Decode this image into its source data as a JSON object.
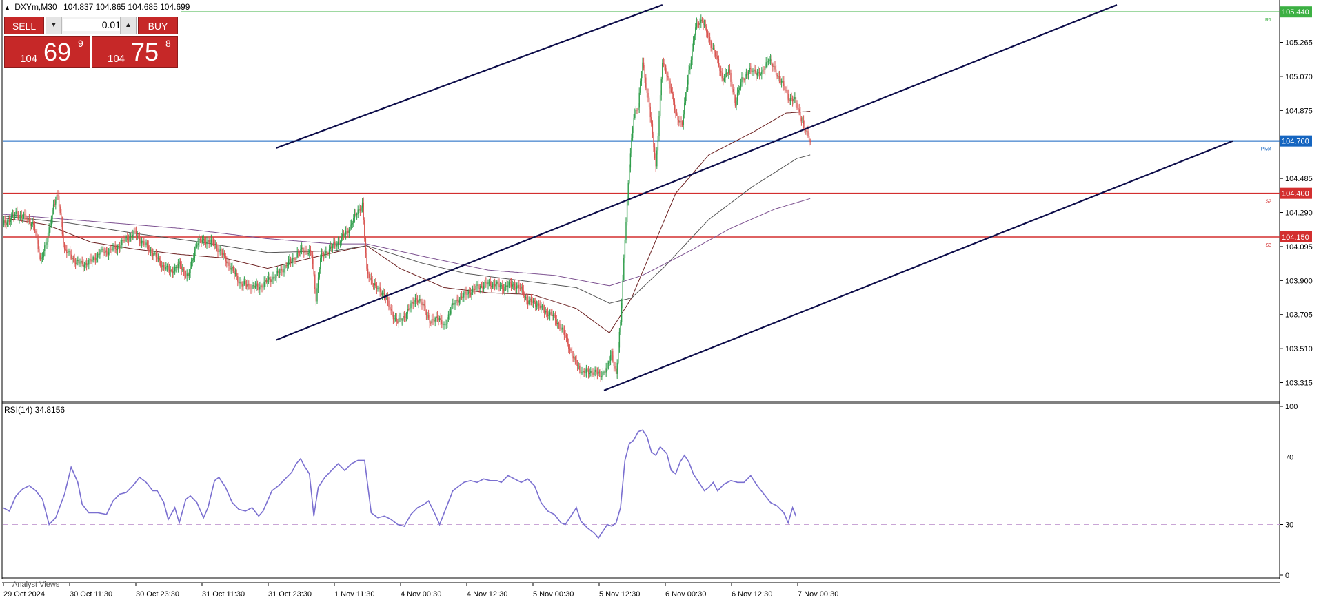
{
  "header": {
    "symbol": "DXYm,M30",
    "ohlc": "104.837 104.865 104.685 104.699"
  },
  "trade_panel": {
    "sell_label": "SELL",
    "buy_label": "BUY",
    "lot": "0.01",
    "bid": {
      "prefix": "104",
      "big": "69",
      "sup": "9"
    },
    "ask": {
      "prefix": "104",
      "big": "75",
      "sup": "8"
    }
  },
  "indicator_label": "RSI(14) 34.8156",
  "footer_label": "Analyst Views",
  "chart_data": [
    {
      "type": "candlestick",
      "title": "DXYm,M30",
      "price_axis_ticks": [
        103.315,
        103.51,
        103.705,
        103.9,
        104.095,
        104.29,
        104.485,
        104.875,
        105.07,
        105.265
      ],
      "time_axis_ticks": [
        "29 Oct 2024",
        "30 Oct 11:30",
        "30 Oct 23:30",
        "31 Oct 11:30",
        "31 Oct 23:30",
        "1 Nov 11:30",
        "4 Nov 00:30",
        "4 Nov 12:30",
        "5 Nov 00:30",
        "5 Nov 12:30",
        "6 Nov 00:30",
        "6 Nov 12:30",
        "7 Nov 00:30"
      ],
      "ylim": [
        103.25,
        105.5
      ],
      "levels": [
        {
          "price": 105.44,
          "label": "105.440",
          "tag": "R1",
          "color": "#3cb043"
        },
        {
          "price": 104.7,
          "label": "104.700",
          "tag": "Pivot",
          "color": "#1565c0"
        },
        {
          "price": 104.4,
          "label": "104.400",
          "tag": "S2",
          "color": "#d32f2f"
        },
        {
          "price": 104.15,
          "label": "104.150",
          "tag": "S3",
          "color": "#d32f2f"
        }
      ],
      "up_color": "#2e9d4a",
      "down_color": "#d9534f",
      "channel_color": "#0d0d4a",
      "close_path": [
        [
          0,
          104.22
        ],
        [
          6,
          104.25
        ],
        [
          12,
          104.28
        ],
        [
          20,
          104.26
        ],
        [
          28,
          104.22
        ],
        [
          34,
          104.02
        ],
        [
          40,
          104.12
        ],
        [
          46,
          104.34
        ],
        [
          50,
          104.38
        ],
        [
          56,
          104.08
        ],
        [
          64,
          104.02
        ],
        [
          72,
          103.99
        ],
        [
          80,
          104.01
        ],
        [
          88,
          104.06
        ],
        [
          96,
          104.07
        ],
        [
          104,
          104.09
        ],
        [
          112,
          104.14
        ],
        [
          120,
          104.17
        ],
        [
          128,
          104.11
        ],
        [
          136,
          104.06
        ],
        [
          144,
          103.99
        ],
        [
          152,
          103.95
        ],
        [
          160,
          103.99
        ],
        [
          168,
          103.92
        ],
        [
          176,
          104.12
        ],
        [
          184,
          104.13
        ],
        [
          192,
          104.11
        ],
        [
          200,
          104.04
        ],
        [
          208,
          103.96
        ],
        [
          216,
          103.88
        ],
        [
          224,
          103.87
        ],
        [
          232,
          103.86
        ],
        [
          240,
          103.9
        ],
        [
          248,
          103.93
        ],
        [
          256,
          103.98
        ],
        [
          264,
          104.03
        ],
        [
          272,
          104.08
        ],
        [
          280,
          104.05
        ],
        [
          284,
          103.8
        ],
        [
          288,
          104.03
        ],
        [
          296,
          104.08
        ],
        [
          304,
          104.12
        ],
        [
          312,
          104.18
        ],
        [
          318,
          104.25
        ],
        [
          322,
          104.3
        ],
        [
          326,
          104.34
        ],
        [
          330,
          103.95
        ],
        [
          338,
          103.86
        ],
        [
          346,
          103.82
        ],
        [
          352,
          103.72
        ],
        [
          358,
          103.66
        ],
        [
          366,
          103.71
        ],
        [
          374,
          103.8
        ],
        [
          382,
          103.75
        ],
        [
          388,
          103.65
        ],
        [
          394,
          103.7
        ],
        [
          400,
          103.63
        ],
        [
          406,
          103.74
        ],
        [
          414,
          103.8
        ],
        [
          422,
          103.83
        ],
        [
          430,
          103.86
        ],
        [
          438,
          103.88
        ],
        [
          446,
          103.88
        ],
        [
          454,
          103.86
        ],
        [
          462,
          103.88
        ],
        [
          470,
          103.85
        ],
        [
          476,
          103.78
        ],
        [
          484,
          103.77
        ],
        [
          490,
          103.73
        ],
        [
          498,
          103.7
        ],
        [
          504,
          103.65
        ],
        [
          510,
          103.58
        ],
        [
          518,
          103.44
        ],
        [
          526,
          103.37
        ],
        [
          534,
          103.38
        ],
        [
          542,
          103.36
        ],
        [
          548,
          103.4
        ],
        [
          552,
          103.49
        ],
        [
          556,
          103.36
        ],
        [
          560,
          103.66
        ],
        [
          564,
          104.15
        ],
        [
          568,
          104.55
        ],
        [
          572,
          104.85
        ],
        [
          576,
          104.9
        ],
        [
          580,
          105.15
        ],
        [
          586,
          104.9
        ],
        [
          592,
          104.55
        ],
        [
          598,
          105.15
        ],
        [
          604,
          105.05
        ],
        [
          610,
          104.85
        ],
        [
          616,
          104.8
        ],
        [
          622,
          105.1
        ],
        [
          628,
          105.35
        ],
        [
          634,
          105.4
        ],
        [
          640,
          105.28
        ],
        [
          646,
          105.2
        ],
        [
          652,
          105.06
        ],
        [
          658,
          105.1
        ],
        [
          664,
          104.92
        ],
        [
          670,
          105.05
        ],
        [
          676,
          105.1
        ],
        [
          682,
          105.1
        ],
        [
          688,
          105.08
        ],
        [
          694,
          105.18
        ],
        [
          700,
          105.1
        ],
        [
          706,
          105.04
        ],
        [
          712,
          104.95
        ],
        [
          718,
          104.93
        ],
        [
          724,
          104.83
        ],
        [
          728,
          104.75
        ],
        [
          732,
          104.7
        ]
      ],
      "moving_averages": [
        {
          "color": "#6b1f1f",
          "values": [
            [
              0,
              104.26
            ],
            [
              40,
              104.22
            ],
            [
              80,
              104.12
            ],
            [
              120,
              104.08
            ],
            [
              160,
              104.05
            ],
            [
              200,
              104.03
            ],
            [
              240,
              103.97
            ],
            [
              280,
              104.03
            ],
            [
              300,
              104.06
            ],
            [
              330,
              104.1
            ],
            [
              360,
              103.97
            ],
            [
              400,
              103.86
            ],
            [
              440,
              103.83
            ],
            [
              480,
              103.82
            ],
            [
              520,
              103.74
            ],
            [
              550,
              103.6
            ],
            [
              570,
              103.8
            ],
            [
              590,
              104.1
            ],
            [
              610,
              104.4
            ],
            [
              640,
              104.62
            ],
            [
              680,
              104.75
            ],
            [
              710,
              104.86
            ],
            [
              732,
              104.87
            ]
          ]
        },
        {
          "color": "#555555",
          "values": [
            [
              0,
              104.27
            ],
            [
              60,
              104.23
            ],
            [
              120,
              104.17
            ],
            [
              180,
              104.12
            ],
            [
              240,
              104.06
            ],
            [
              300,
              104.07
            ],
            [
              330,
              104.1
            ],
            [
              380,
              104.0
            ],
            [
              420,
              103.94
            ],
            [
              470,
              103.9
            ],
            [
              520,
              103.86
            ],
            [
              550,
              103.77
            ],
            [
              570,
              103.8
            ],
            [
              600,
              103.98
            ],
            [
              640,
              104.25
            ],
            [
              680,
              104.44
            ],
            [
              720,
              104.6
            ],
            [
              732,
              104.62
            ]
          ]
        },
        {
          "color": "#7b4f8f",
          "values": [
            [
              0,
              104.28
            ],
            [
              80,
              104.24
            ],
            [
              160,
              104.2
            ],
            [
              240,
              104.14
            ],
            [
              300,
              104.11
            ],
            [
              330,
              104.11
            ],
            [
              380,
              104.04
            ],
            [
              440,
              103.96
            ],
            [
              500,
              103.93
            ],
            [
              550,
              103.87
            ],
            [
              580,
              103.93
            ],
            [
              620,
              104.06
            ],
            [
              660,
              104.2
            ],
            [
              700,
              104.31
            ],
            [
              732,
              104.37
            ]
          ]
        }
      ],
      "channel_lines": [
        {
          "from": [
            248,
            104.66
          ],
          "to": [
            598,
            105.48
          ]
        },
        {
          "from": [
            248,
            103.56
          ],
          "to": [
            1010,
            105.48
          ]
        },
        {
          "from": [
            545,
            103.27
          ],
          "to": [
            1115,
            104.7
          ]
        }
      ]
    },
    {
      "type": "line",
      "title": "RSI(14) 34.8156",
      "ylim": [
        0,
        100
      ],
      "y_ticks": [
        0,
        30,
        70,
        100
      ],
      "levels": [
        30,
        70
      ],
      "color": "#7a6fd0",
      "values": [
        [
          0,
          40
        ],
        [
          6,
          38
        ],
        [
          12,
          47
        ],
        [
          18,
          51
        ],
        [
          24,
          53
        ],
        [
          30,
          50
        ],
        [
          36,
          45
        ],
        [
          42,
          30
        ],
        [
          48,
          34
        ],
        [
          56,
          48
        ],
        [
          62,
          64
        ],
        [
          68,
          55
        ],
        [
          72,
          42
        ],
        [
          78,
          37
        ],
        [
          86,
          37
        ],
        [
          94,
          36
        ],
        [
          100,
          44
        ],
        [
          106,
          48
        ],
        [
          112,
          49
        ],
        [
          118,
          53
        ],
        [
          124,
          58
        ],
        [
          130,
          55
        ],
        [
          136,
          50
        ],
        [
          140,
          50
        ],
        [
          146,
          43
        ],
        [
          150,
          33
        ],
        [
          156,
          40
        ],
        [
          160,
          31
        ],
        [
          166,
          45
        ],
        [
          170,
          47
        ],
        [
          176,
          43
        ],
        [
          182,
          34
        ],
        [
          186,
          40
        ],
        [
          192,
          56
        ],
        [
          196,
          58
        ],
        [
          202,
          52
        ],
        [
          208,
          43
        ],
        [
          214,
          39
        ],
        [
          220,
          38
        ],
        [
          226,
          40
        ],
        [
          232,
          35
        ],
        [
          236,
          38
        ],
        [
          244,
          50
        ],
        [
          250,
          53
        ],
        [
          256,
          57
        ],
        [
          262,
          61
        ],
        [
          266,
          66
        ],
        [
          270,
          69
        ],
        [
          274,
          64
        ],
        [
          278,
          60
        ],
        [
          282,
          35
        ],
        [
          286,
          52
        ],
        [
          292,
          58
        ],
        [
          298,
          62
        ],
        [
          304,
          66
        ],
        [
          310,
          62
        ],
        [
          316,
          66
        ],
        [
          322,
          68
        ],
        [
          328,
          68
        ],
        [
          334,
          37
        ],
        [
          340,
          34
        ],
        [
          346,
          35
        ],
        [
          352,
          33
        ],
        [
          358,
          30
        ],
        [
          364,
          29
        ],
        [
          370,
          36
        ],
        [
          376,
          40
        ],
        [
          382,
          42
        ],
        [
          386,
          44
        ],
        [
          392,
          36
        ],
        [
          396,
          30
        ],
        [
          402,
          40
        ],
        [
          408,
          50
        ],
        [
          412,
          52
        ],
        [
          418,
          55
        ],
        [
          424,
          56
        ],
        [
          430,
          55
        ],
        [
          436,
          57
        ],
        [
          442,
          56
        ],
        [
          448,
          56
        ],
        [
          452,
          55
        ],
        [
          458,
          59
        ],
        [
          464,
          57
        ],
        [
          470,
          55
        ],
        [
          476,
          57
        ],
        [
          482,
          53
        ],
        [
          488,
          43
        ],
        [
          494,
          38
        ],
        [
          500,
          36
        ],
        [
          506,
          31
        ],
        [
          510,
          30
        ],
        [
          516,
          36
        ],
        [
          520,
          40
        ],
        [
          524,
          32
        ],
        [
          530,
          28
        ],
        [
          536,
          25
        ],
        [
          540,
          22
        ],
        [
          544,
          26
        ],
        [
          548,
          30
        ],
        [
          552,
          29
        ],
        [
          556,
          31
        ],
        [
          560,
          40
        ],
        [
          564,
          68
        ],
        [
          568,
          78
        ],
        [
          572,
          80
        ],
        [
          576,
          85
        ],
        [
          580,
          86
        ],
        [
          584,
          82
        ],
        [
          588,
          73
        ],
        [
          592,
          71
        ],
        [
          596,
          76
        ],
        [
          602,
          72
        ],
        [
          606,
          62
        ],
        [
          610,
          60
        ],
        [
          614,
          67
        ],
        [
          618,
          71
        ],
        [
          622,
          67
        ],
        [
          626,
          60
        ],
        [
          630,
          56
        ],
        [
          636,
          50
        ],
        [
          640,
          52
        ],
        [
          644,
          55
        ],
        [
          648,
          50
        ],
        [
          654,
          54
        ],
        [
          660,
          56
        ],
        [
          666,
          55
        ],
        [
          672,
          55
        ],
        [
          678,
          59
        ],
        [
          684,
          53
        ],
        [
          690,
          48
        ],
        [
          696,
          43
        ],
        [
          702,
          41
        ],
        [
          708,
          37
        ],
        [
          712,
          31
        ],
        [
          716,
          40
        ],
        [
          719,
          35
        ]
      ]
    }
  ]
}
